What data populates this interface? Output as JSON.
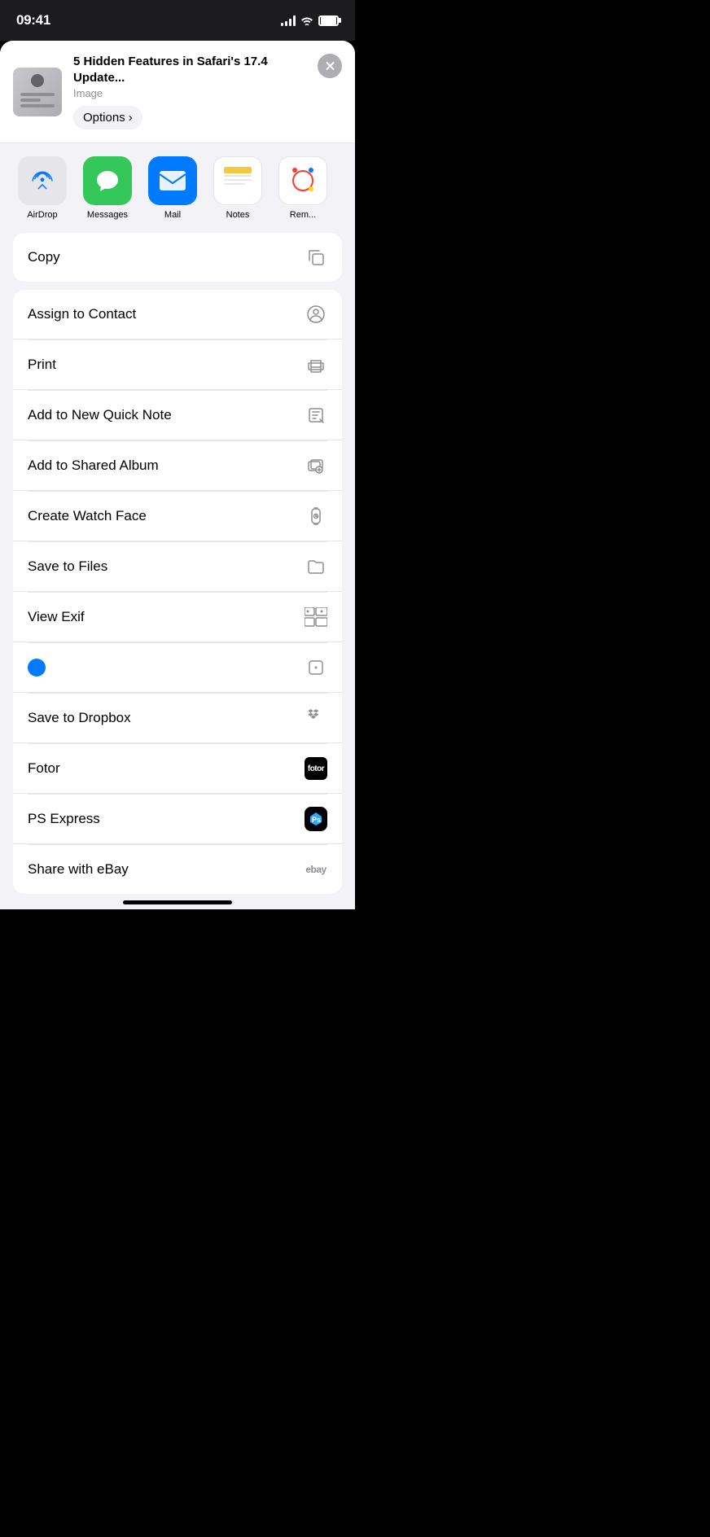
{
  "statusBar": {
    "time": "09:41"
  },
  "shareSheet": {
    "title": "5 Hidden Features in Safari's 17.4 Update...",
    "subtitle": "Image",
    "optionsLabel": "Options",
    "optionsChevron": "›",
    "closeLabel": "×"
  },
  "apps": [
    {
      "id": "airdrop",
      "label": "AirDrop"
    },
    {
      "id": "messages",
      "label": "Messages"
    },
    {
      "id": "mail",
      "label": "Mail"
    },
    {
      "id": "notes",
      "label": "Notes"
    },
    {
      "id": "reminders",
      "label": "Rem..."
    }
  ],
  "actions": {
    "copyGroup": [
      {
        "id": "copy",
        "label": "Copy"
      }
    ],
    "mainGroup": [
      {
        "id": "assign-contact",
        "label": "Assign to Contact"
      },
      {
        "id": "print",
        "label": "Print"
      },
      {
        "id": "quick-note",
        "label": "Add to New Quick Note"
      },
      {
        "id": "shared-album",
        "label": "Add to Shared Album"
      },
      {
        "id": "watch-face",
        "label": "Create Watch Face"
      },
      {
        "id": "save-files",
        "label": "Save to Files"
      },
      {
        "id": "view-exif",
        "label": "View Exif"
      },
      {
        "id": "unknown-blue",
        "label": ""
      },
      {
        "id": "dropbox",
        "label": "Save to Dropbox"
      },
      {
        "id": "fotor",
        "label": "Fotor"
      },
      {
        "id": "ps-express",
        "label": "PS Express"
      },
      {
        "id": "ebay",
        "label": "Share with eBay"
      }
    ]
  }
}
